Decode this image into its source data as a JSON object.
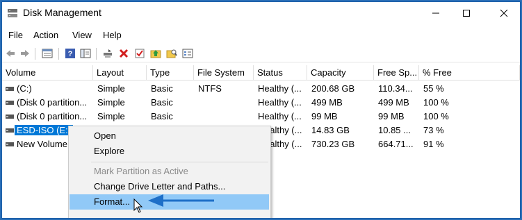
{
  "window": {
    "title": "Disk Management",
    "minimize_icon": "minimize-icon",
    "maximize_icon": "maximize-icon",
    "close_icon": "close-icon"
  },
  "menubar": {
    "file": "File",
    "action": "Action",
    "view": "View",
    "help": "Help"
  },
  "toolbar": {
    "icons": [
      "back-arrow-icon",
      "forward-arrow-icon",
      "properties-icon",
      "help-icon",
      "console-tree-icon",
      "connect-drive-icon",
      "delete-icon",
      "check-icon",
      "up-folder-icon",
      "search-folder-icon",
      "list-view-icon"
    ]
  },
  "table": {
    "headers": [
      "Volume",
      "Layout",
      "Type",
      "File System",
      "Status",
      "Capacity",
      "Free Sp...",
      "% Free"
    ],
    "rows": [
      {
        "volume": " (C:)",
        "layout": "Simple",
        "type": "Basic",
        "fs": "NTFS",
        "status": "Healthy (...",
        "capacity": "200.68 GB",
        "free": "110.34...",
        "pct": "55 %"
      },
      {
        "volume": "(Disk 0 partition...",
        "layout": "Simple",
        "type": "Basic",
        "fs": "",
        "status": "Healthy (...",
        "capacity": "499 MB",
        "free": "499 MB",
        "pct": "100 %"
      },
      {
        "volume": "(Disk 0 partition...",
        "layout": "Simple",
        "type": "Basic",
        "fs": "",
        "status": "Healthy (...",
        "capacity": "99 MB",
        "free": "99 MB",
        "pct": "100 %"
      },
      {
        "volume": "ESD-ISO (E:)",
        "layout": "",
        "type": "",
        "fs": "",
        "status": "ealthy (...",
        "capacity": "14.83 GB",
        "free": "10.85 ...",
        "pct": "73 %"
      },
      {
        "volume": "New Volume",
        "layout": "",
        "type": "",
        "fs": "",
        "status": "ealthy (...",
        "capacity": "730.23 GB",
        "free": "664.71...",
        "pct": "91 %"
      }
    ]
  },
  "context_menu": {
    "open": "Open",
    "explore": "Explore",
    "mark_active": "Mark Partition as Active",
    "change_letter": "Change Drive Letter and Paths...",
    "format": "Format..."
  },
  "colors": {
    "accent": "#0078d7",
    "highlight": "#91c9f7",
    "arrow": "#1e6fc8",
    "frame": "#2a6fb8"
  }
}
